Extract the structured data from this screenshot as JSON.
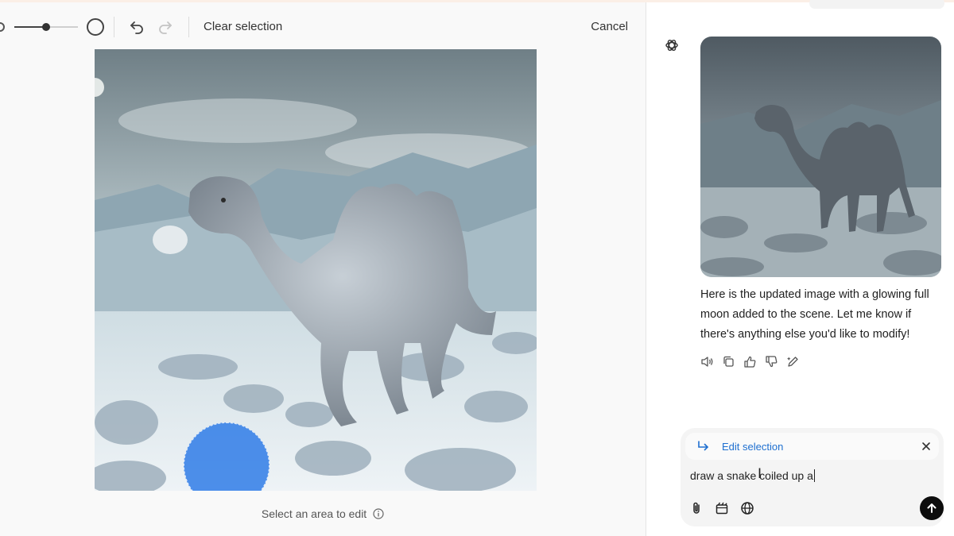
{
  "toolbar": {
    "brush_size_level": 0.5,
    "clear_selection_label": "Clear selection",
    "cancel_label": "Cancel",
    "icons": [
      "brush-small-icon",
      "brush-large-icon",
      "undo-icon",
      "redo-icon"
    ]
  },
  "editor": {
    "image_alt": "Fluffy two-humped camel walking in a frosty desert",
    "hint": "Select an area to edit",
    "hint_icon": "info-icon"
  },
  "chat": {
    "assistant_icon": "openai-logo-icon",
    "thumbnail_alt": "Updated image of the camel with a glowing full moon",
    "message": "Here is the updated image with a glowing full moon added to the scene. Let me know if there's anything else you'd like to modify!",
    "actions": [
      "read-aloud-icon",
      "copy-icon",
      "thumbs-up-icon",
      "thumbs-down-icon",
      "edit-image-icon"
    ]
  },
  "composer": {
    "edit_tag_label": "Edit selection",
    "prompt_value": "draw a snake coiled up a",
    "tools": [
      "attach-icon",
      "create-image-icon",
      "web-search-icon"
    ],
    "send_icon": "arrow-up-icon"
  },
  "colors": {
    "accent_blue": "#1e6fd0",
    "selection_fill": "#2878e6",
    "send_button": "#0d0d0d"
  }
}
